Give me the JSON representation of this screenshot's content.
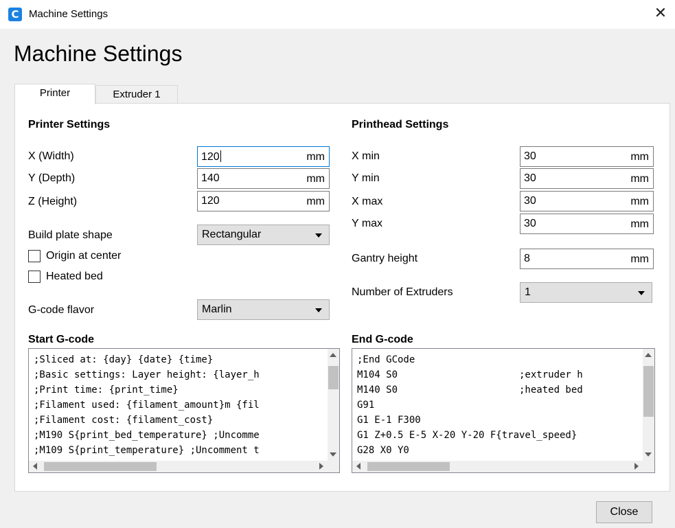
{
  "window": {
    "title": "Machine Settings",
    "close_glyph": "✕",
    "logo_glyph": "C"
  },
  "heading": "Machine Settings",
  "tabs": [
    {
      "label": "Printer",
      "active": true
    },
    {
      "label": "Extruder 1",
      "active": false
    }
  ],
  "printer_settings": {
    "title": "Printer Settings",
    "x": {
      "label": "X (Width)",
      "value": "120",
      "unit": "mm"
    },
    "y": {
      "label": "Y (Depth)",
      "value": "140",
      "unit": "mm"
    },
    "z": {
      "label": "Z (Height)",
      "value": "120",
      "unit": "mm"
    },
    "build_plate": {
      "label": "Build plate shape",
      "value": "Rectangular"
    },
    "origin_center": {
      "label": "Origin at center",
      "checked": false
    },
    "heated_bed": {
      "label": "Heated bed",
      "checked": false
    },
    "gcode_flavor": {
      "label": "G-code flavor",
      "value": "Marlin"
    }
  },
  "printhead_settings": {
    "title": "Printhead Settings",
    "x_min": {
      "label": "X min",
      "value": "30",
      "unit": "mm"
    },
    "y_min": {
      "label": "Y min",
      "value": "30",
      "unit": "mm"
    },
    "x_max": {
      "label": "X max",
      "value": "30",
      "unit": "mm"
    },
    "y_max": {
      "label": "Y max",
      "value": "30",
      "unit": "mm"
    },
    "gantry": {
      "label": "Gantry height",
      "value": "8",
      "unit": "mm"
    },
    "extruders": {
      "label": "Number of Extruders",
      "value": "1"
    }
  },
  "start_gcode": {
    "title": "Start G-code",
    "text": ";Sliced at: {day} {date} {time}\n;Basic settings: Layer height: {layer_h\n;Print time: {print_time}\n;Filament used: {filament_amount}m {fil\n;Filament cost: {filament_cost}\n;M190 S{print_bed_temperature} ;Uncomme\n;M109 S{print_temperature} ;Uncomment t"
  },
  "end_gcode": {
    "title": "End G-code",
    "text": ";End GCode\nM104 S0                     ;extruder h\nM140 S0                     ;heated bed\nG91\nG1 E-1 F300\nG1 Z+0.5 E-5 X-20 Y-20 F{travel_speed}\nG28 X0 Y0"
  },
  "close_button": "Close"
}
